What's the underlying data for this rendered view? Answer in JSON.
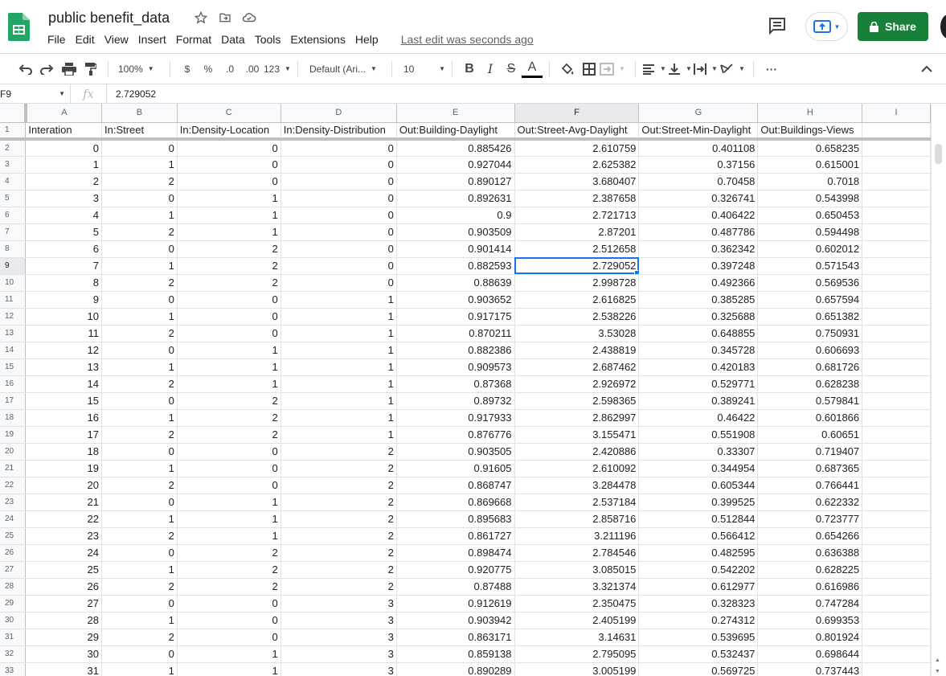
{
  "header": {
    "title": "public benefit_data",
    "menus": [
      "File",
      "Edit",
      "View",
      "Insert",
      "Format",
      "Data",
      "Tools",
      "Extensions",
      "Help"
    ],
    "last_edit": "Last edit was seconds ago",
    "share_label": "Share"
  },
  "toolbar": {
    "zoom": "100%",
    "currency": "$",
    "percent": "%",
    "decrease_decimal": ".0",
    "increase_decimal": ".00",
    "more_formats": "123",
    "font": "Default (Ari...",
    "font_size": "10",
    "more": "···"
  },
  "formula_bar": {
    "cell_ref": "F9",
    "fx": "fx",
    "value": "2.729052"
  },
  "sheet": {
    "columns": [
      "A",
      "B",
      "C",
      "D",
      "E",
      "F",
      "G",
      "H",
      "I"
    ],
    "selected_column": "F",
    "selected_row": 9,
    "headers": [
      "Interation",
      "In:Street",
      "In:Density-Location",
      "In:Density-Distribution",
      "Out:Building-Daylight",
      "Out:Street-Avg-Daylight",
      "Out:Street-Min-Daylight",
      "Out:Buildings-Views"
    ],
    "rows": [
      [
        "0",
        "0",
        "0",
        "0",
        "0.885426",
        "2.610759",
        "0.401108",
        "0.658235"
      ],
      [
        "1",
        "1",
        "0",
        "0",
        "0.927044",
        "2.625382",
        "0.37156",
        "0.615001"
      ],
      [
        "2",
        "2",
        "0",
        "0",
        "0.890127",
        "3.680407",
        "0.70458",
        "0.7018"
      ],
      [
        "3",
        "0",
        "1",
        "0",
        "0.892631",
        "2.387658",
        "0.326741",
        "0.543998"
      ],
      [
        "4",
        "1",
        "1",
        "0",
        "0.9",
        "2.721713",
        "0.406422",
        "0.650453"
      ],
      [
        "5",
        "2",
        "1",
        "0",
        "0.903509",
        "2.87201",
        "0.487786",
        "0.594498"
      ],
      [
        "6",
        "0",
        "2",
        "0",
        "0.901414",
        "2.512658",
        "0.362342",
        "0.602012"
      ],
      [
        "7",
        "1",
        "2",
        "0",
        "0.882593",
        "2.729052",
        "0.397248",
        "0.571543"
      ],
      [
        "8",
        "2",
        "2",
        "0",
        "0.88639",
        "2.998728",
        "0.492366",
        "0.569536"
      ],
      [
        "9",
        "0",
        "0",
        "1",
        "0.903652",
        "2.616825",
        "0.385285",
        "0.657594"
      ],
      [
        "10",
        "1",
        "0",
        "1",
        "0.917175",
        "2.538226",
        "0.325688",
        "0.651382"
      ],
      [
        "11",
        "2",
        "0",
        "1",
        "0.870211",
        "3.53028",
        "0.648855",
        "0.750931"
      ],
      [
        "12",
        "0",
        "1",
        "1",
        "0.882386",
        "2.438819",
        "0.345728",
        "0.606693"
      ],
      [
        "13",
        "1",
        "1",
        "1",
        "0.909573",
        "2.687462",
        "0.420183",
        "0.681726"
      ],
      [
        "14",
        "2",
        "1",
        "1",
        "0.87368",
        "2.926972",
        "0.529771",
        "0.628238"
      ],
      [
        "15",
        "0",
        "2",
        "1",
        "0.89732",
        "2.598365",
        "0.389241",
        "0.579841"
      ],
      [
        "16",
        "1",
        "2",
        "1",
        "0.917933",
        "2.862997",
        "0.46422",
        "0.601866"
      ],
      [
        "17",
        "2",
        "2",
        "1",
        "0.876776",
        "3.155471",
        "0.551908",
        "0.60651"
      ],
      [
        "18",
        "0",
        "0",
        "2",
        "0.903505",
        "2.420886",
        "0.33307",
        "0.719407"
      ],
      [
        "19",
        "1",
        "0",
        "2",
        "0.91605",
        "2.610092",
        "0.344954",
        "0.687365"
      ],
      [
        "20",
        "2",
        "0",
        "2",
        "0.868747",
        "3.284478",
        "0.605344",
        "0.766441"
      ],
      [
        "21",
        "0",
        "1",
        "2",
        "0.869668",
        "2.537184",
        "0.399525",
        "0.622332"
      ],
      [
        "22",
        "1",
        "1",
        "2",
        "0.895683",
        "2.858716",
        "0.512844",
        "0.723777"
      ],
      [
        "23",
        "2",
        "1",
        "2",
        "0.861727",
        "3.211196",
        "0.566412",
        "0.654266"
      ],
      [
        "24",
        "0",
        "2",
        "2",
        "0.898474",
        "2.784546",
        "0.482595",
        "0.636388"
      ],
      [
        "25",
        "1",
        "2",
        "2",
        "0.920775",
        "3.085015",
        "0.542202",
        "0.628225"
      ],
      [
        "26",
        "2",
        "2",
        "2",
        "0.87488",
        "3.321374",
        "0.612977",
        "0.616986"
      ],
      [
        "27",
        "0",
        "0",
        "3",
        "0.912619",
        "2.350475",
        "0.328323",
        "0.747284"
      ],
      [
        "28",
        "1",
        "0",
        "3",
        "0.903942",
        "2.405199",
        "0.274312",
        "0.699353"
      ],
      [
        "29",
        "2",
        "0",
        "3",
        "0.863171",
        "3.14631",
        "0.539695",
        "0.801924"
      ],
      [
        "30",
        "0",
        "1",
        "3",
        "0.859138",
        "2.795095",
        "0.532437",
        "0.698644"
      ],
      [
        "31",
        "1",
        "1",
        "3",
        "0.890289",
        "3.005199",
        "0.569725",
        "0.737443"
      ]
    ]
  }
}
